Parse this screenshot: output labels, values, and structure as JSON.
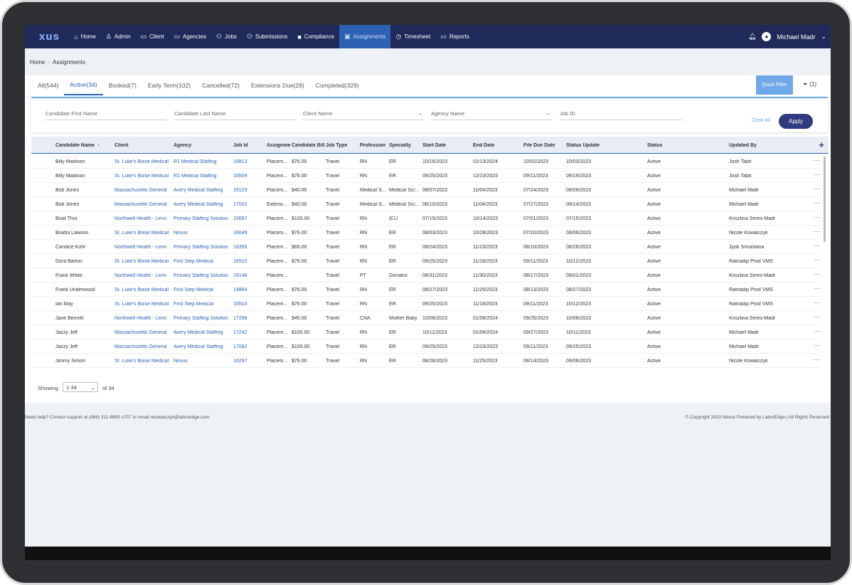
{
  "nav": {
    "logo": "xus",
    "items": [
      {
        "icon": "⌂",
        "label": "Home"
      },
      {
        "icon": "♙",
        "label": "Admin"
      },
      {
        "icon": "▭",
        "label": "Client"
      },
      {
        "icon": "▭",
        "label": "Agencies"
      },
      {
        "icon": "⚇",
        "label": "Jobs"
      },
      {
        "icon": "⚇",
        "label": "Submissions"
      },
      {
        "icon": "■",
        "label": "Compliance"
      },
      {
        "icon": "▣",
        "label": "Assignments"
      },
      {
        "icon": "◷",
        "label": "Timesheet"
      },
      {
        "icon": "▭",
        "label": "Reports"
      }
    ],
    "active": "Assignments",
    "user": "Michael Madr"
  },
  "breadcrumb": {
    "home": "Home",
    "current": "Assignments"
  },
  "tabs": [
    {
      "label": "All(544)"
    },
    {
      "label": "Active(34)"
    },
    {
      "label": "Booked(7)"
    },
    {
      "label": "Early Term(102)"
    },
    {
      "label": "Cancelled(72)"
    },
    {
      "label": "Extensions Due(29)"
    },
    {
      "label": "Completed(329)"
    }
  ],
  "quick_filter": "Quick Filter",
  "filter_count": "(1)",
  "filters": {
    "first_name": "Candidate First Name",
    "last_name": "Candidate Last Name",
    "client_name": "Client Name",
    "agency_name": "Agency Name",
    "job_id": "Job ID",
    "clear_all": "Clear All",
    "apply": "Apply"
  },
  "columns": [
    "Candidate Name",
    "Client",
    "Agency",
    "Job Id",
    "Assignment",
    "Candidate Bill",
    "Job Type",
    "Profession",
    "Specialty",
    "Start Date",
    "End Date",
    "File Due Date",
    "Status Update",
    "Status",
    "Updated By"
  ],
  "sort_icon": "↑",
  "rows": [
    [
      "Billy Madison",
      "St. Luke's Boise Medical",
      "R1 Medical Staffing",
      "16813",
      "Placem...",
      "$76.00",
      "Travel",
      "RN",
      "ER",
      "10/16/2023",
      "01/13/2024",
      "10/02/2023",
      "10/03/2023",
      "Active",
      "Josh Tabit"
    ],
    [
      "Billy Madison",
      "St. Luke's Boise Medical",
      "R1 Medical Staffing",
      "16509",
      "Placem...",
      "$76.00",
      "Travel",
      "RN",
      "ER",
      "09/25/2023",
      "12/23/2023",
      "09/11/2023",
      "09/19/2023",
      "Active",
      "Josh Tabit"
    ],
    [
      "Bob Jones",
      "Massachusetts General",
      "Avery Medical Staffing",
      "16123",
      "Placem...",
      "$40.00",
      "Travel",
      "Medical S...",
      "Medical Scr...",
      "08/07/2023",
      "11/04/2023",
      "07/24/2023",
      "08/09/2023",
      "Active",
      "Michael Madr"
    ],
    [
      "Bob Jones",
      "Massachusetts General",
      "Avery Medical Staffing",
      "17002",
      "Extensi...",
      "$40.00",
      "Travel",
      "Medical S...",
      "Medical Scr...",
      "08/10/2023",
      "11/04/2023",
      "07/27/2023",
      "09/14/2023",
      "Active",
      "Michael Madr"
    ],
    [
      "Brad Thor",
      "Northwell Health - Lenn",
      "Primary Staffing Solution",
      "15697",
      "Placem...",
      "$100.00",
      "Travel",
      "RN",
      "ICU",
      "07/15/2023",
      "10/14/2023",
      "07/01/2023",
      "07/15/2023",
      "Active",
      "Krisztina Seres-Madr"
    ],
    [
      "Bradni Lawson",
      "St. Luke's Boise Medical",
      "Nexus",
      "16049",
      "Placem...",
      "$76.00",
      "Travel",
      "RN",
      "ER",
      "08/03/2023",
      "10/28/2023",
      "07/20/2023",
      "09/06/2023",
      "Active",
      "Nicole Kowalczyk"
    ],
    [
      "Candice Kohl",
      "Northwell Health - Lenn",
      "Primary Staffing Solution",
      "16356",
      "Placem...",
      "$65.00",
      "Travel",
      "RN",
      "ER",
      "08/24/2023",
      "11/23/2023",
      "08/10/2023",
      "08/26/2023",
      "Active",
      "Jyoti Srivastana"
    ],
    [
      "Dora Barton",
      "St. Luke's Boise Medical",
      "First Step Medical",
      "16510",
      "Placem...",
      "$76.00",
      "Travel",
      "RN",
      "ER",
      "09/25/2023",
      "11/18/2023",
      "09/11/2023",
      "10/12/2023",
      "Active",
      "Ratnadip Prod VMS"
    ],
    [
      "Frank White",
      "Northwell Health - Lenn",
      "Primary Staffing Solution",
      "16148",
      "Placem...",
      "",
      "Travel",
      "PT",
      "Geriatric",
      "08/31/2023",
      "11/30/2023",
      "08/17/2023",
      "09/01/2023",
      "Active",
      "Krisztina Seres-Madr"
    ],
    [
      "Frank Underwood",
      "St. Luke's Boise Medical",
      "First Step Medical",
      "14884",
      "Placem...",
      "$76.00",
      "Travel",
      "RN",
      "ER",
      "08/27/2023",
      "11/25/2023",
      "08/13/2023",
      "08/27/2023",
      "Active",
      "Ratnadip Prod VMS"
    ],
    [
      "Ian May",
      "St. Luke's Boise Medical",
      "First Step Medical",
      "16510",
      "Placem...",
      "$76.00",
      "Travel",
      "RN",
      "ER",
      "09/25/2023",
      "11/18/2023",
      "09/11/2023",
      "10/12/2023",
      "Active",
      "Ratnadip Prod VMS"
    ],
    [
      "Jane Bennet",
      "Northwell Health - Lenn",
      "Primary Staffing Solution",
      "17298",
      "Placem...",
      "$45.00",
      "Travel",
      "CNA",
      "Mother Baby",
      "10/09/2023",
      "01/06/2024",
      "09/25/2023",
      "10/09/2023",
      "Active",
      "Krisztina Seres-Madr"
    ],
    [
      "Jazzy Jeff",
      "Massachusetts General",
      "Avery Medical Staffing",
      "17242",
      "Placem...",
      "$100.00",
      "Travel",
      "RN",
      "ER",
      "10/11/2023",
      "01/06/2024",
      "09/27/2023",
      "10/11/2023",
      "Active",
      "Michael Madr"
    ],
    [
      "Jazzy Jeff",
      "Massachusetts General",
      "Avery Medical Staffing",
      "17082",
      "Placem...",
      "$100.00",
      "Travel",
      "RN",
      "ER",
      "09/25/2023",
      "12/23/2023",
      "09/11/2023",
      "09/25/2023",
      "Active",
      "Michael Madr"
    ],
    [
      "Jimmy Simon",
      "St. Luke's Boise Medical",
      "Nexus",
      "16297",
      "Placem...",
      "$76.00",
      "Travel",
      "RN",
      "ER",
      "08/28/2023",
      "11/25/2023",
      "08/14/2023",
      "09/06/2023",
      "Active",
      "Nicole Kowalczyk"
    ]
  ],
  "pager": {
    "showing": "Showing",
    "range": "1-34",
    "of": "of 34"
  },
  "footer": {
    "help": "Need help? Contact support at (888) 311-8885 x707 or email nkowalczyk@laboredge.com",
    "copyright": "© Copyright 2023 Nexus Powered by LaborEdge | All Rights Reserved"
  }
}
